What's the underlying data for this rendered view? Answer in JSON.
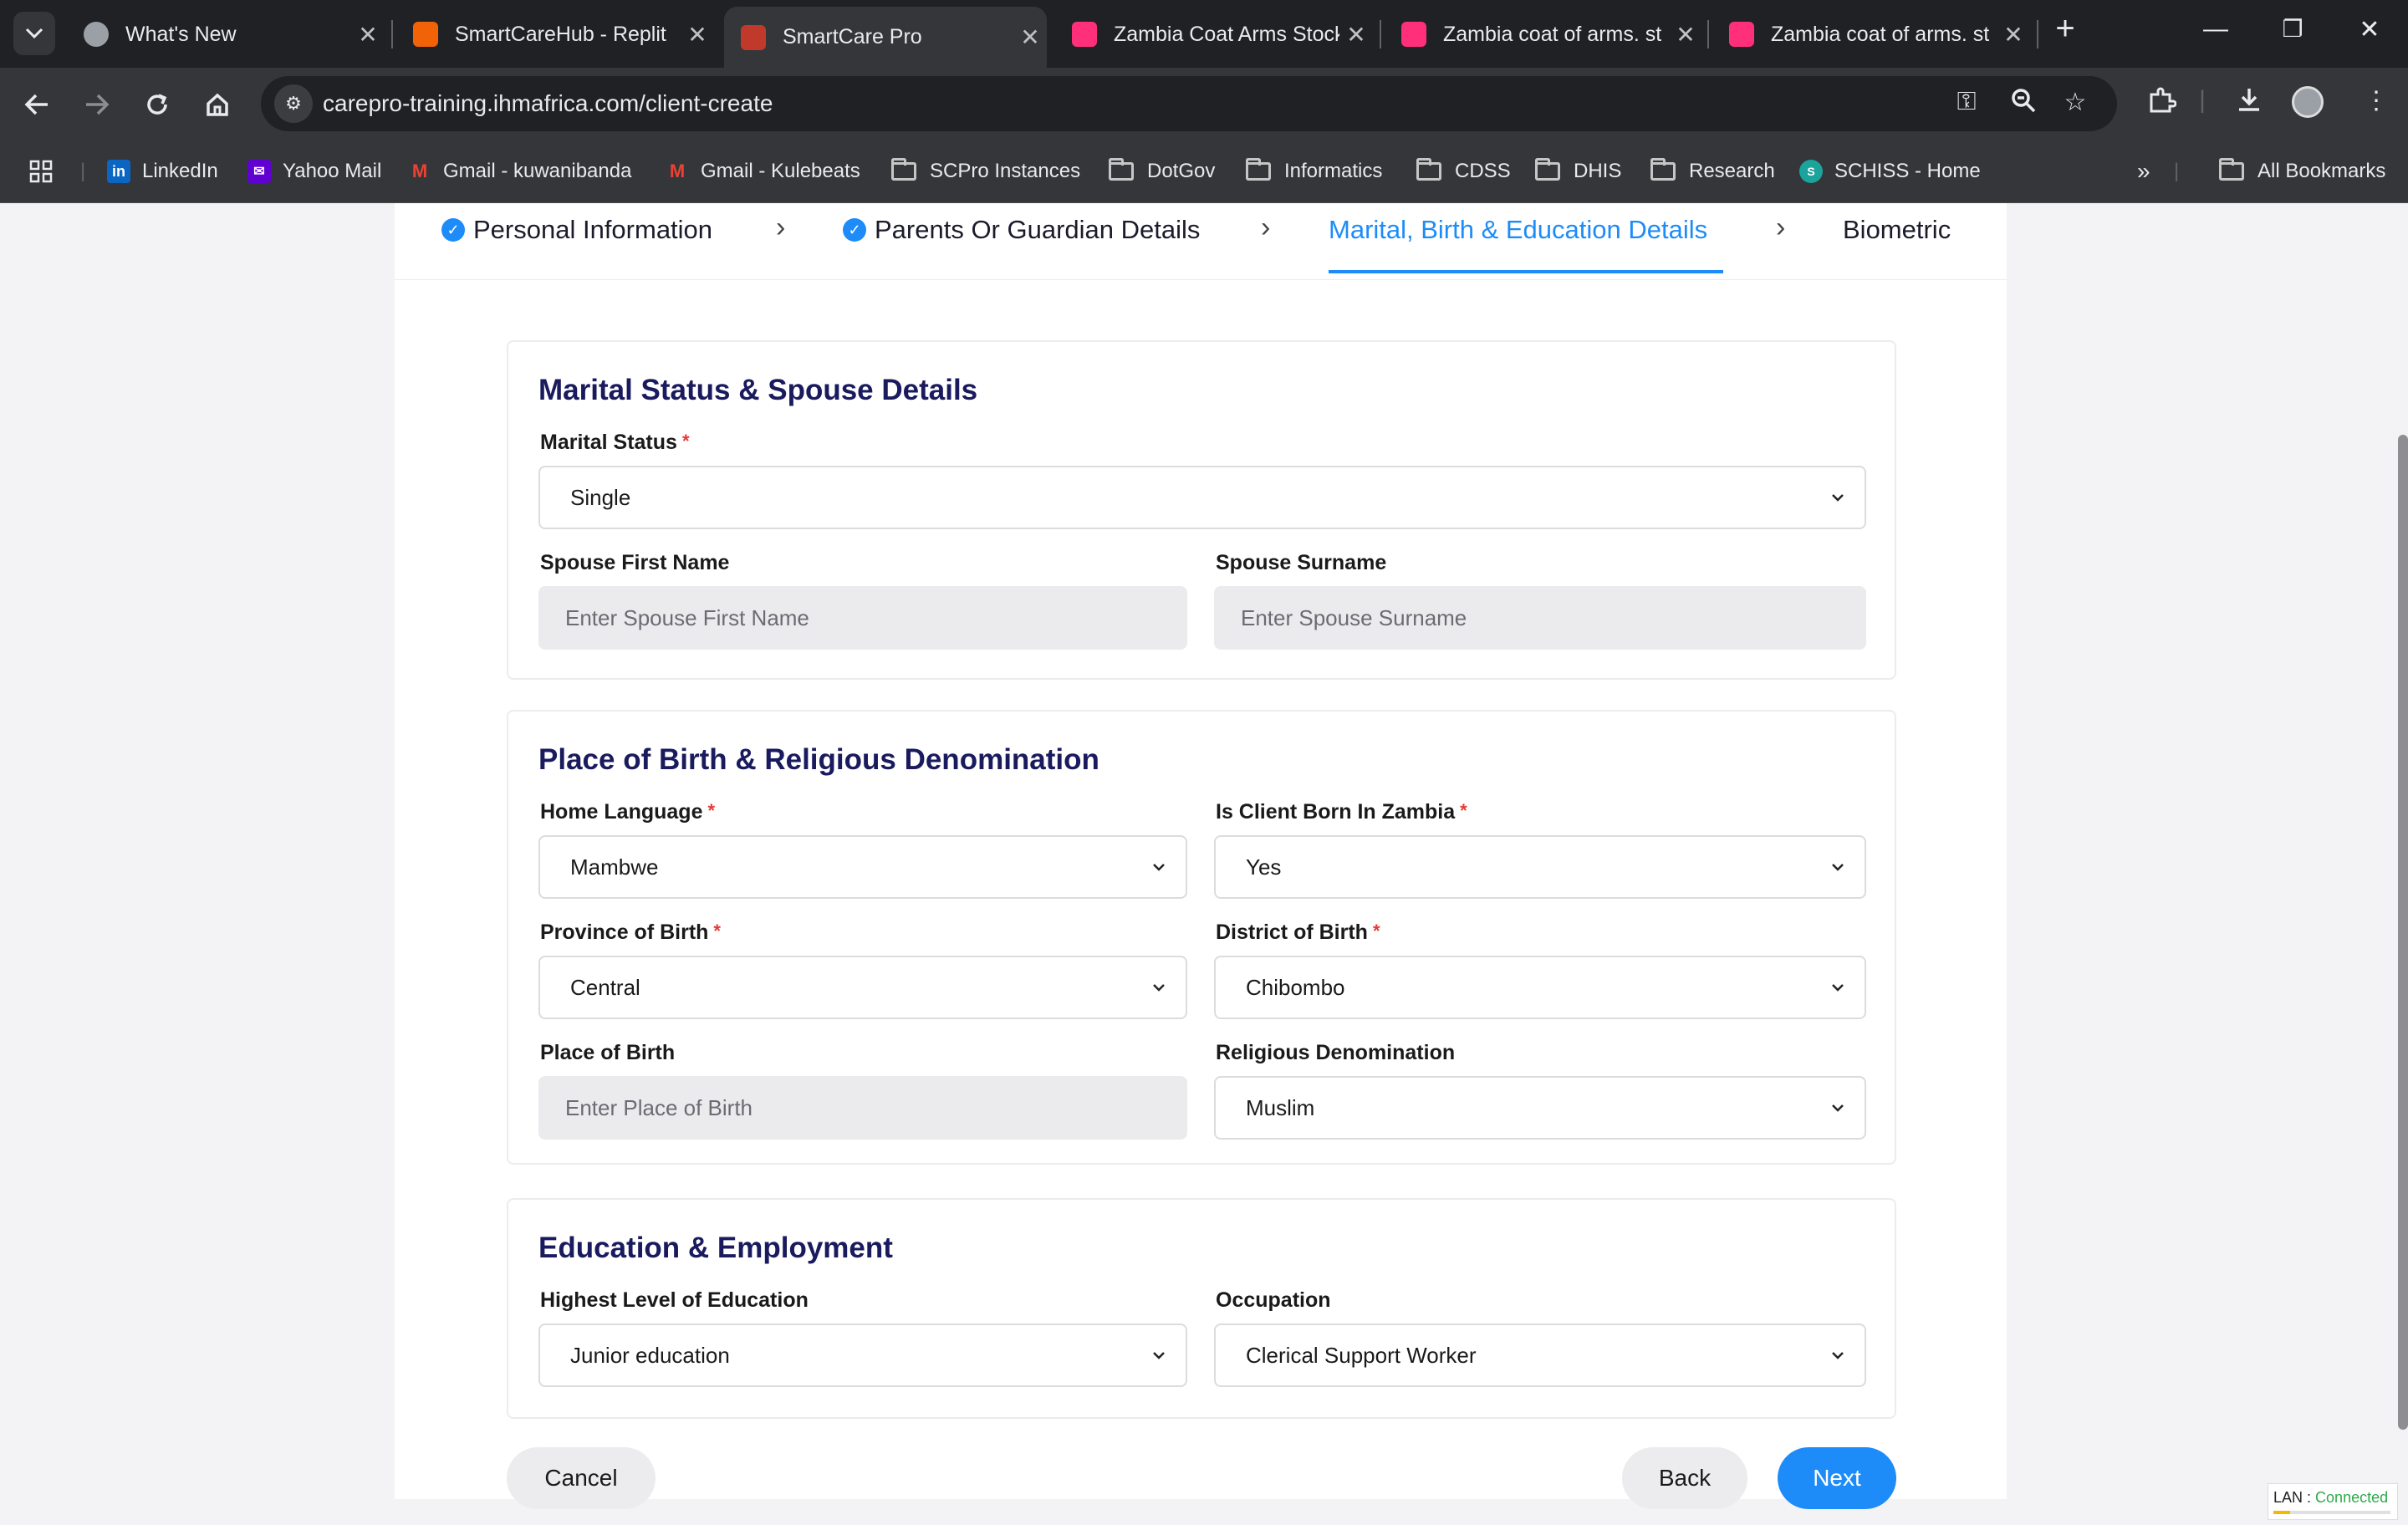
{
  "browser": {
    "tabs": [
      {
        "title": "What's New",
        "favicon_color": "#9aa0a6"
      },
      {
        "title": "SmartCareHub - Replit",
        "favicon_color": "#f26207"
      },
      {
        "title": "SmartCare Pro",
        "favicon_color": "#c0392b",
        "active": true
      },
      {
        "title": "Zambia Coat Arms Stock",
        "favicon_color": "#ff2f7a"
      },
      {
        "title": "Zambia coat of arms. st",
        "favicon_color": "#ff2f7a"
      },
      {
        "title": "Zambia coat of arms. st",
        "favicon_color": "#ff2f7a"
      }
    ],
    "url": "carepro-training.ihmafrica.com/client-create",
    "bookmarks": [
      {
        "label": "LinkedIn",
        "icon": "linkedin-icon"
      },
      {
        "label": "Yahoo Mail",
        "icon": "yahoo-icon"
      },
      {
        "label": "Gmail - kuwanibanda",
        "icon": "gmail-icon"
      },
      {
        "label": "Gmail - Kulebeats",
        "icon": "gmail-icon"
      },
      {
        "label": "SCPro Instances",
        "icon": "folder-icon"
      },
      {
        "label": "DotGov",
        "icon": "folder-icon"
      },
      {
        "label": "Informatics",
        "icon": "folder-icon"
      },
      {
        "label": "CDSS",
        "icon": "folder-icon"
      },
      {
        "label": "DHIS",
        "icon": "folder-icon"
      },
      {
        "label": "Research",
        "icon": "folder-icon"
      },
      {
        "label": "SCHISS - Home",
        "icon": "schiss-icon"
      }
    ],
    "all_bookmarks": "All Bookmarks"
  },
  "wizard": {
    "steps": [
      {
        "label": "Personal Information",
        "state": "done"
      },
      {
        "label": "Parents Or Guardian Details",
        "state": "done"
      },
      {
        "label": "Marital, Birth & Education Details",
        "state": "current"
      },
      {
        "label": "Biometric",
        "state": "pending"
      }
    ]
  },
  "marital": {
    "title": "Marital Status & Spouse Details",
    "status_label": "Marital Status",
    "status_value": "Single",
    "spouse_first_label": "Spouse First Name",
    "spouse_first_placeholder": "Enter Spouse First Name",
    "spouse_surname_label": "Spouse Surname",
    "spouse_surname_placeholder": "Enter Spouse Surname"
  },
  "birth": {
    "title": "Place of Birth & Religious Denomination",
    "language_label": "Home Language",
    "language_value": "Mambwe",
    "born_zambia_label": "Is Client Born In Zambia",
    "born_zambia_value": "Yes",
    "province_label": "Province of Birth",
    "province_value": "Central",
    "district_label": "District of Birth",
    "district_value": "Chibombo",
    "place_label": "Place of Birth",
    "place_placeholder": "Enter Place of Birth",
    "religion_label": "Religious Denomination",
    "religion_value": "Muslim"
  },
  "education": {
    "title": "Education & Employment",
    "level_label": "Highest Level of Education",
    "level_value": "Junior education",
    "occupation_label": "Occupation",
    "occupation_value": "Clerical Support Worker"
  },
  "actions": {
    "cancel": "Cancel",
    "back": "Back",
    "next": "Next"
  },
  "status": {
    "lan_label": "LAN :",
    "lan_value": "Connected"
  },
  "required_mark": "*",
  "colors": {
    "accent": "#1d8cf8",
    "heading": "#1a1a5e",
    "required": "#e53935"
  }
}
